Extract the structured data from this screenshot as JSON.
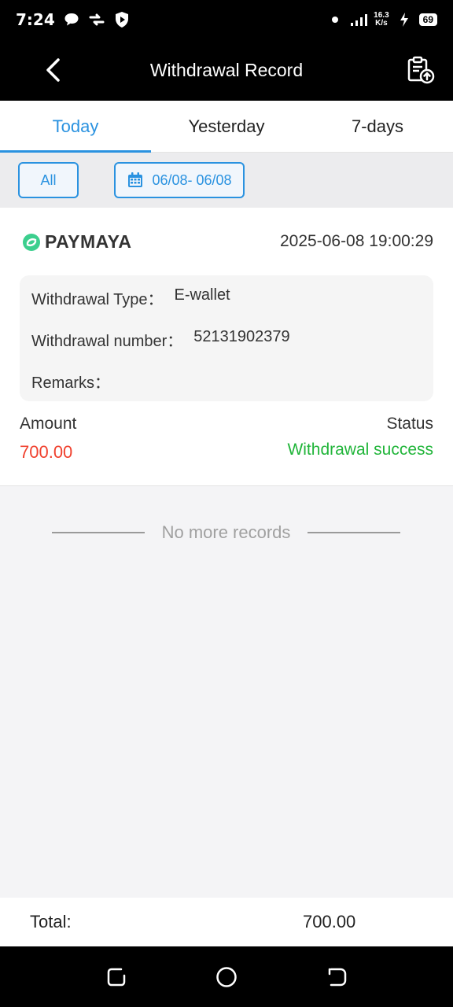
{
  "status_bar": {
    "time": "7:24",
    "speed_value": "16.3",
    "speed_unit": "K/s",
    "battery": "69",
    "icons": [
      "chat-bubble-icon",
      "vpn-icon",
      "shield-play-icon",
      "dot-icon",
      "signal-icon",
      "charging-icon",
      "battery-icon"
    ]
  },
  "header": {
    "title": "Withdrawal Record",
    "back_icon": "chevron-left-icon",
    "export_icon": "clipboard-upload-icon"
  },
  "tabs": [
    {
      "label": "Today",
      "active": true
    },
    {
      "label": "Yesterday",
      "active": false
    },
    {
      "label": "7-days",
      "active": false
    }
  ],
  "filters": {
    "all_label": "All",
    "date_range": "06/08- 06/08",
    "calendar_icon": "calendar-icon"
  },
  "record": {
    "provider": "PAYMAYA",
    "datetime": "2025-06-08 19:00:29",
    "details": {
      "type_label": "Withdrawal Type：",
      "type_value": "E-wallet",
      "number_label": "Withdrawal number：",
      "number_value": "52131902379",
      "remarks_label": "Remarks：",
      "remarks_value": ""
    },
    "amount_label": "Amount",
    "amount_value": "700.00",
    "status_label": "Status",
    "status_value": "Withdrawal success"
  },
  "list_end": "No more records",
  "total": {
    "label": "Total:",
    "value": "700.00"
  },
  "colors": {
    "accent": "#2a92e0",
    "amount": "#f0412e",
    "success": "#21b53a",
    "brand_green": "#3ccf8e"
  }
}
